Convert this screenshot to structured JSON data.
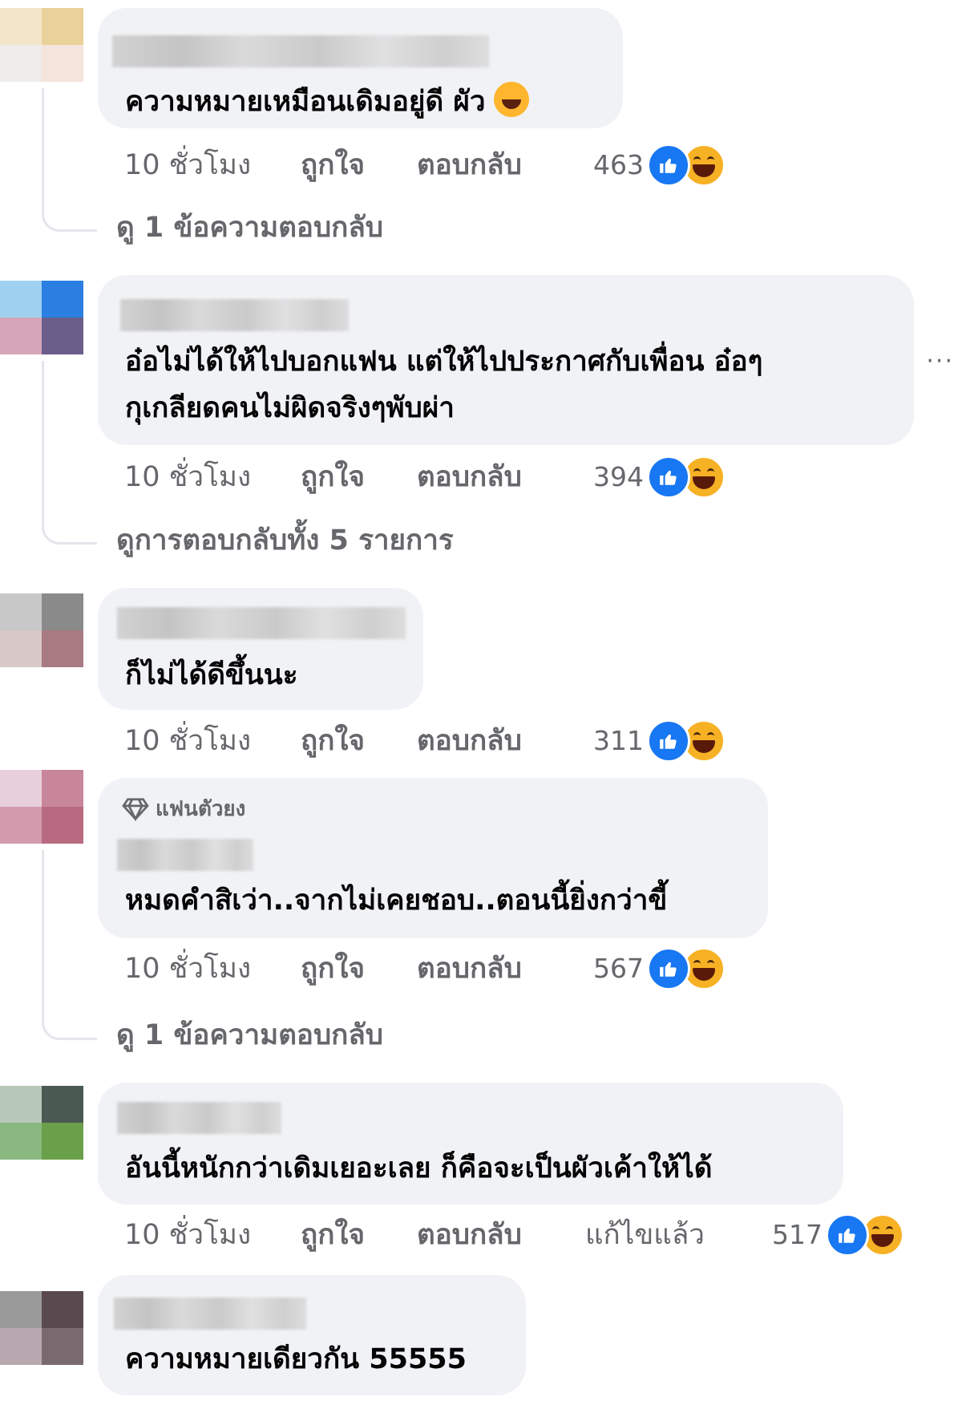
{
  "actions": {
    "like": "ถูกใจ",
    "reply": "ตอบกลับ",
    "edited": "แก้ไขแล้ว"
  },
  "more_label": "···",
  "comments": [
    {
      "text": "ความหมายเหมือนเดิมอยู่ดี ผัว",
      "emoji": "rofl-emoji-icon",
      "timestamp": "10 ชั่วโมง",
      "reaction_count": "463",
      "view_replies": "ดู 1 ข้อความตอบกลับ",
      "avatar_colors": [
        "#f3e6c8",
        "#ead199",
        "#f0ecec",
        "#f4e4dc"
      ]
    },
    {
      "text_line1": "อ๋อไม่ได้ให้ไปบอกแฟน แต่ให้ไปประกาศกับเพื่อน อ๋อๆ",
      "text_line2": "กุเกลียดคนไม่ผิดจริงๆพับผ่า",
      "timestamp": "10 ชั่วโมง",
      "reaction_count": "394",
      "view_replies": "ดูการตอบกลับทั้ง 5 รายการ",
      "avatar_colors": [
        "#9fd0f0",
        "#2a7fe0",
        "#d7a5b8",
        "#6c5e8a"
      ]
    },
    {
      "text": "ก็ไม่ได้ดีขึ้นนะ",
      "timestamp": "10 ชั่วโมง",
      "reaction_count": "311",
      "avatar_colors": [
        "#c8c8c8",
        "#8a8a8a",
        "#d8c8c8",
        "#a87a82"
      ]
    },
    {
      "badge": "แฟนตัวยง",
      "text": "หมดคำสิเว่า..จากไม่เคยชอบ..ตอนนี้ยิ่งกว่าขี้",
      "timestamp": "10 ชั่วโมง",
      "reaction_count": "567",
      "view_replies": "ดู 1 ข้อความตอบกลับ",
      "avatar_colors": [
        "#e8d0da",
        "#c8869a",
        "#d49aae",
        "#b86a80"
      ]
    },
    {
      "text": "อันนี้หนักกว่าเดิมเยอะเลย ก็คือจะเป็นผัวเค้าให้ได้",
      "timestamp": "10 ชั่วโมง",
      "edited": true,
      "reaction_count": "517",
      "avatar_colors": [
        "#b8c8b8",
        "#4a5a52",
        "#8ab880",
        "#6aa04a"
      ]
    },
    {
      "text": "ความหมายเดียวกัน 55555",
      "avatar_colors": [
        "#9a9a9a",
        "#5a4a50",
        "#b8a8b0",
        "#7a6a70"
      ]
    }
  ]
}
